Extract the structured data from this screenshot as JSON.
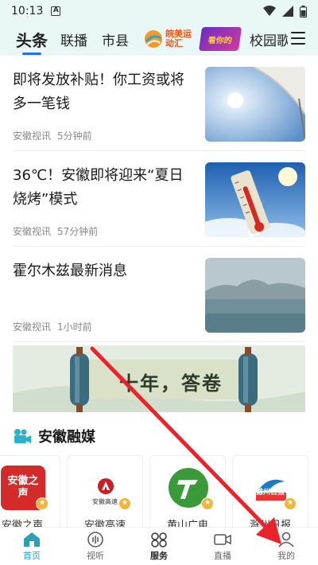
{
  "status_bar": {
    "time": "10:13",
    "a_badge": "A"
  },
  "channels": {
    "tabs": [
      "头条",
      "联播",
      "市县"
    ],
    "sport_logo_text": "皖美运动汇",
    "game_logo_text": "看你的",
    "last_tab": "校园歌"
  },
  "news": [
    {
      "title": "即将发放补贴！你工资或将多一笔钱",
      "source": "安徽视讯",
      "time": "5分钟前"
    },
    {
      "title": "36℃！安徽即将迎来“夏日烧烤”模式",
      "source": "安徽视讯",
      "time": "57分钟前"
    },
    {
      "title": "霍尔木兹最新消息",
      "source": "安徽视讯",
      "time": "1小时前"
    }
  ],
  "banner": {
    "text": "十年，答卷"
  },
  "section": {
    "title": "安徽融媒"
  },
  "accounts": [
    {
      "name": "安徽之声",
      "logo_text": "安徽之声",
      "color": "#d42a2a"
    },
    {
      "name": "安徽高速",
      "logo_text": "安徽高速",
      "color": "#c71f25"
    },
    {
      "name": "黄山广电",
      "logo_text": "",
      "color": "#3a9a3a"
    },
    {
      "name": "滁州日报",
      "logo_text": "滁州日报",
      "color": "#1e78c8"
    }
  ],
  "bottom_nav": [
    {
      "label": "首页",
      "icon": "home-icon"
    },
    {
      "label": "视听",
      "icon": "audio-icon"
    },
    {
      "label": "服务",
      "icon": "service-icon"
    },
    {
      "label": "直播",
      "icon": "video-icon"
    },
    {
      "label": "我的",
      "icon": "person-icon"
    }
  ],
  "colors": {
    "accent": "#2a6df4",
    "active_nav": "#2a9fb5",
    "annotation": "#e8242a"
  }
}
